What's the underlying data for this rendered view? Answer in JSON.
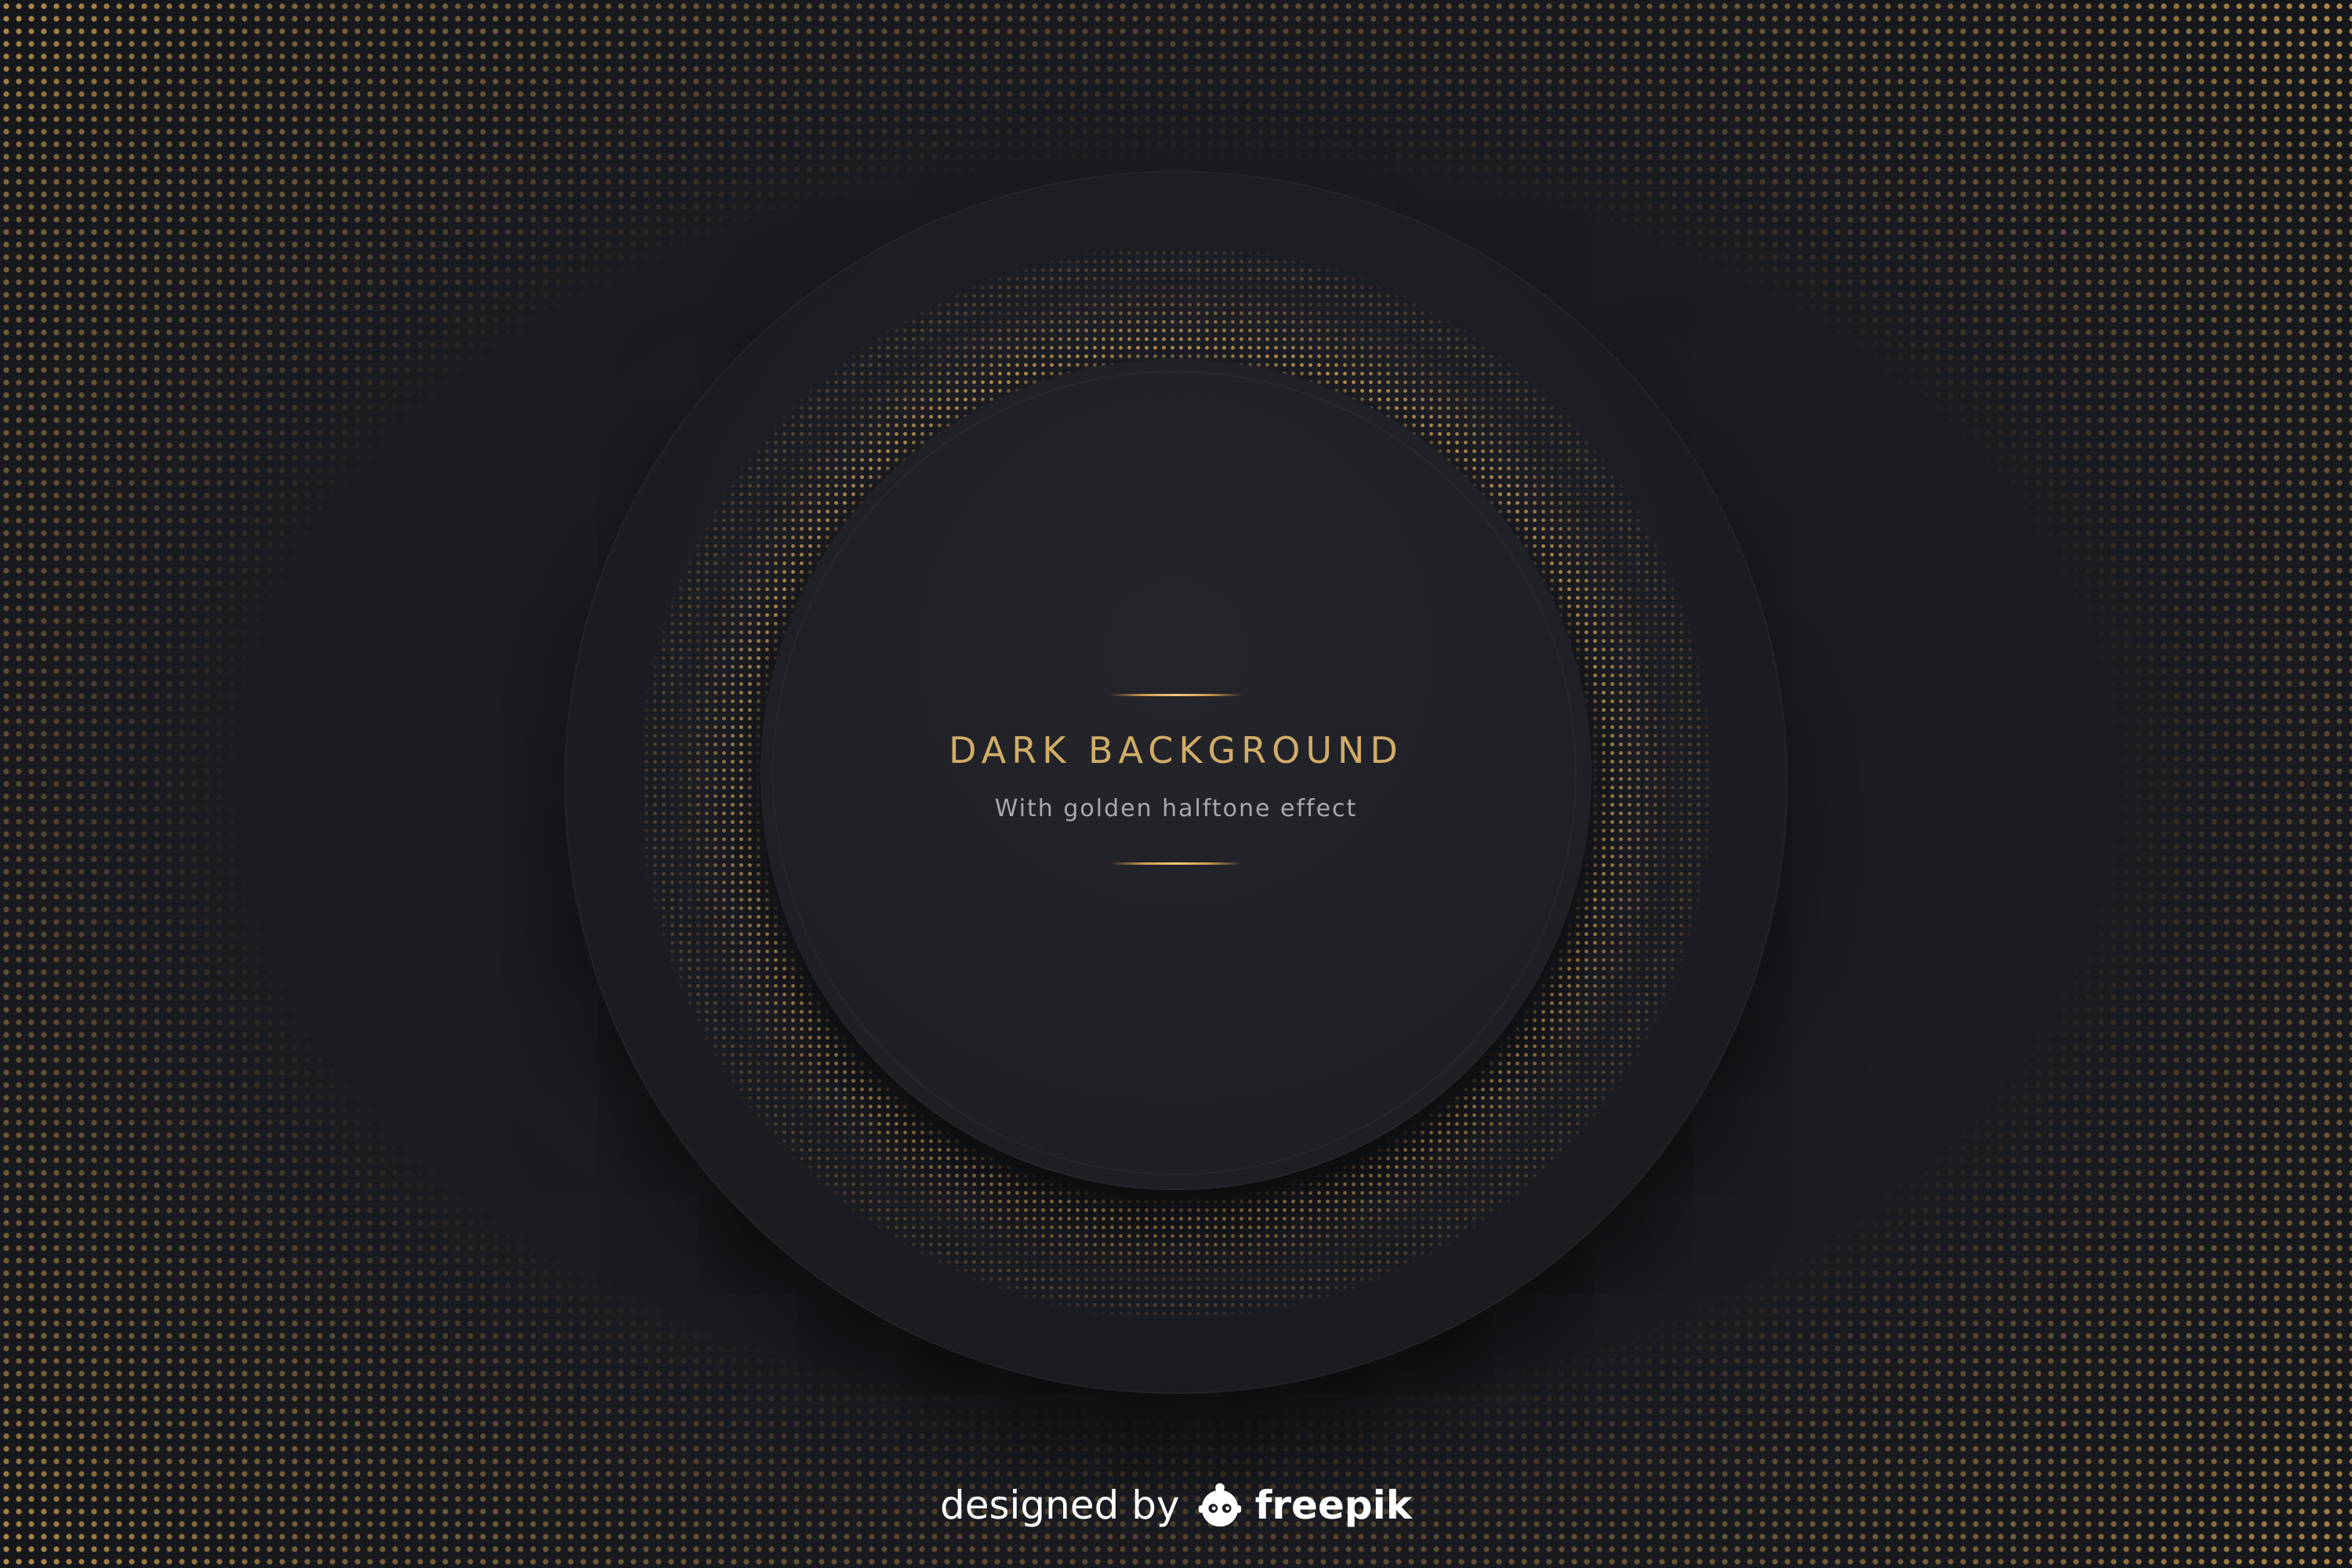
{
  "graphic": {
    "title": "DARK BACKGROUND",
    "subtitle": "With golden halftone effect"
  },
  "credit": {
    "prefix": "designed by",
    "brand": "freepik",
    "icon": "freepik-logo-icon"
  },
  "colors": {
    "background": "#1b1c21",
    "gold": "#d2ad68",
    "subtitle_gray": "#a8a9ae",
    "credit_white": "#ffffff"
  }
}
